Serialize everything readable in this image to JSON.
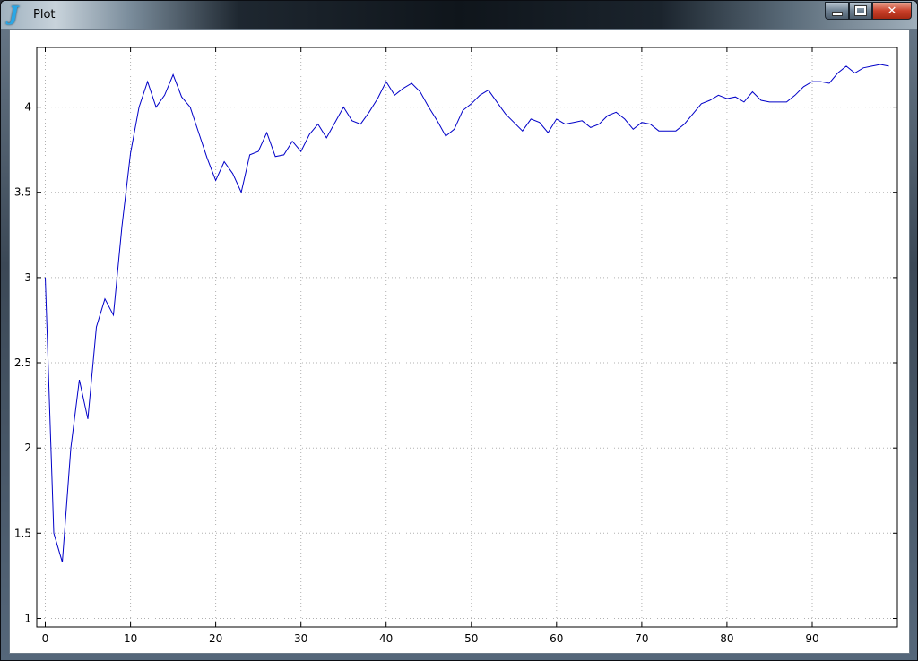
{
  "window": {
    "title": "Plot",
    "app_icon_glyph": "J",
    "app_icon_name": "j-app-icon",
    "buttons": {
      "minimize": "minimize-icon",
      "maximize": "maximize-icon",
      "close": "close-icon",
      "close_glyph": "✕"
    },
    "colors": {
      "line": "#0000c8",
      "grid": "#b0b0b0",
      "background": "#ffffff"
    }
  },
  "chart_data": {
    "type": "line",
    "title": "",
    "xlabel": "",
    "ylabel": "",
    "xlim": [
      -1,
      100
    ],
    "ylim": [
      0.95,
      4.35
    ],
    "grid": true,
    "xticks": [
      0,
      10,
      20,
      30,
      40,
      50,
      60,
      70,
      80,
      90
    ],
    "yticks": [
      1,
      1.5,
      2,
      2.5,
      3,
      3.5,
      4
    ],
    "ytick_labels": [
      "1",
      "1.5",
      "2",
      "2.5",
      "3",
      "3.5",
      "4"
    ],
    "x": [
      0,
      1,
      2,
      3,
      4,
      5,
      6,
      7,
      8,
      9,
      10,
      11,
      12,
      13,
      14,
      15,
      16,
      17,
      18,
      19,
      20,
      21,
      22,
      23,
      24,
      25,
      26,
      27,
      28,
      29,
      30,
      31,
      32,
      33,
      34,
      35,
      36,
      37,
      38,
      39,
      40,
      41,
      42,
      43,
      44,
      45,
      46,
      47,
      48,
      49,
      50,
      51,
      52,
      53,
      54,
      55,
      56,
      57,
      58,
      59,
      60,
      61,
      62,
      63,
      64,
      65,
      66,
      67,
      68,
      69,
      70,
      71,
      72,
      73,
      74,
      75,
      76,
      77,
      78,
      79,
      80,
      81,
      82,
      83,
      84,
      85,
      86,
      87,
      88,
      89,
      90,
      91,
      92,
      93,
      94,
      95,
      96,
      97,
      98,
      99
    ],
    "series": [
      {
        "values": [
          3.0,
          1.5,
          1.33,
          2.0,
          2.4,
          2.17,
          2.71,
          2.875,
          2.78,
          3.3,
          3.73,
          4.0,
          4.15,
          4.0,
          4.07,
          4.19,
          4.06,
          4.0,
          3.85,
          3.7,
          3.57,
          3.68,
          3.61,
          3.5,
          3.72,
          3.74,
          3.85,
          3.71,
          3.72,
          3.8,
          3.74,
          3.84,
          3.9,
          3.82,
          3.91,
          4.0,
          3.92,
          3.9,
          3.97,
          4.05,
          4.15,
          4.07,
          4.11,
          4.14,
          4.09,
          4.0,
          3.92,
          3.83,
          3.87,
          3.98,
          4.02,
          4.07,
          4.1,
          4.03,
          3.96,
          3.91,
          3.86,
          3.93,
          3.91,
          3.85,
          3.93,
          3.9,
          3.91,
          3.92,
          3.88,
          3.9,
          3.95,
          3.97,
          3.93,
          3.87,
          3.91,
          3.9,
          3.86,
          3.86,
          3.86,
          3.9,
          3.96,
          4.02,
          4.04,
          4.07,
          4.05,
          4.06,
          4.03,
          4.09,
          4.04,
          4.03,
          4.03,
          4.03,
          4.07,
          4.12,
          4.15,
          4.15,
          4.14,
          4.2,
          4.24,
          4.2,
          4.23,
          4.24,
          4.25,
          4.24
        ]
      }
    ]
  }
}
